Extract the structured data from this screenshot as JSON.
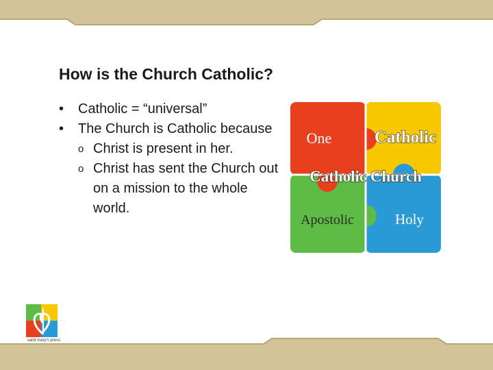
{
  "slide": {
    "title": "How is the Church Catholic?",
    "bullets": [
      {
        "text": "Catholic = “universal”"
      },
      {
        "text": "The Church is Catholic because",
        "subbullets": [
          "Christ is present in her.",
          "Christ has sent the Church out on a mission to the whole world."
        ]
      }
    ],
    "bullet_glyph": "•",
    "subbullet_glyph": "o"
  },
  "puzzle": {
    "one": "One",
    "catholic": "Catholic",
    "center": "Catholic Church",
    "apostolic": "Apostolic",
    "holy": "Holy",
    "colors": {
      "red": "#e8401f",
      "yellow": "#f7c700",
      "green": "#5dbb46",
      "blue": "#2a9ad6"
    }
  },
  "logo": {
    "caption": "saint mary's press"
  },
  "theme": {
    "band_color": "#d3c398",
    "band_dark": "#b8a674"
  }
}
